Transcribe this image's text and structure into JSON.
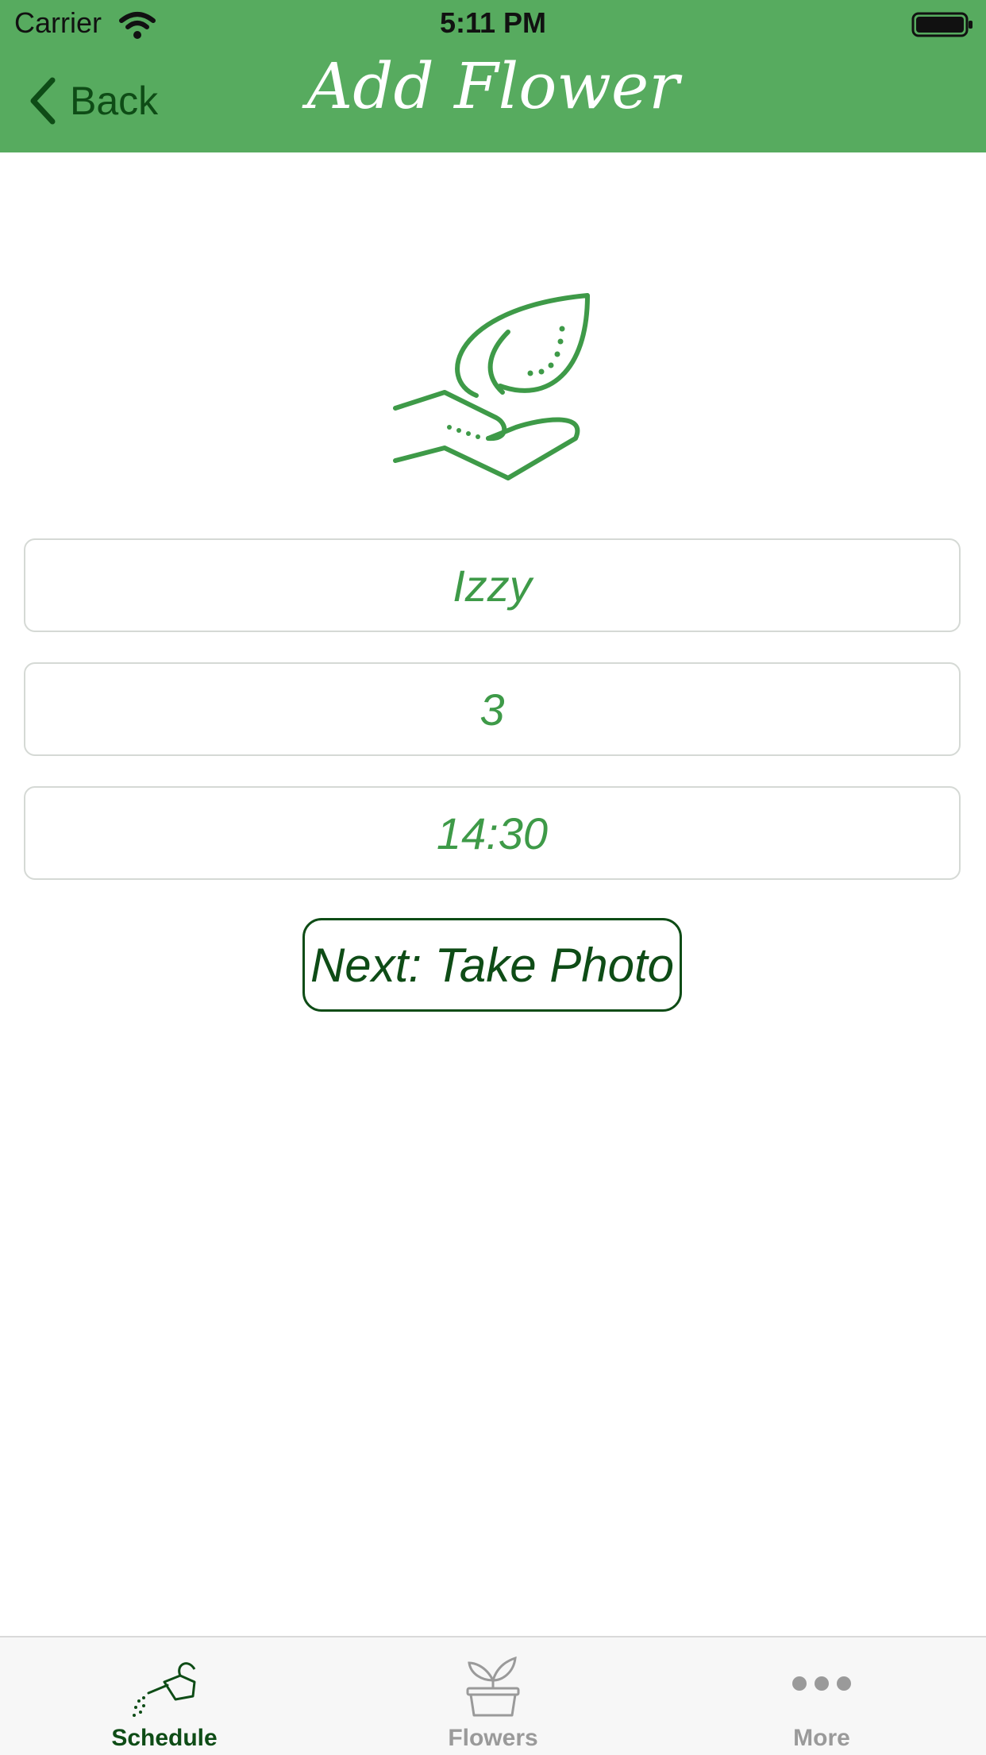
{
  "status_bar": {
    "carrier": "Carrier",
    "time": "5:11 PM"
  },
  "nav": {
    "back_label": "Back",
    "title": "Add Flower"
  },
  "form": {
    "name_value": "Izzy",
    "days_value": "3",
    "time_value": "14:30",
    "next_button_label": "Next: Take Photo"
  },
  "tabs": [
    {
      "label": "Schedule",
      "icon": "watering-can-icon",
      "active": true
    },
    {
      "label": "Flowers",
      "icon": "potted-plant-icon",
      "active": false
    },
    {
      "label": "More",
      "icon": "more-dots-icon",
      "active": false
    }
  ],
  "colors": {
    "header_green": "#57ab5f",
    "dark_green": "#0e4c16",
    "field_text_green": "#3e9a48",
    "inactive_gray": "#9a9a9a"
  }
}
